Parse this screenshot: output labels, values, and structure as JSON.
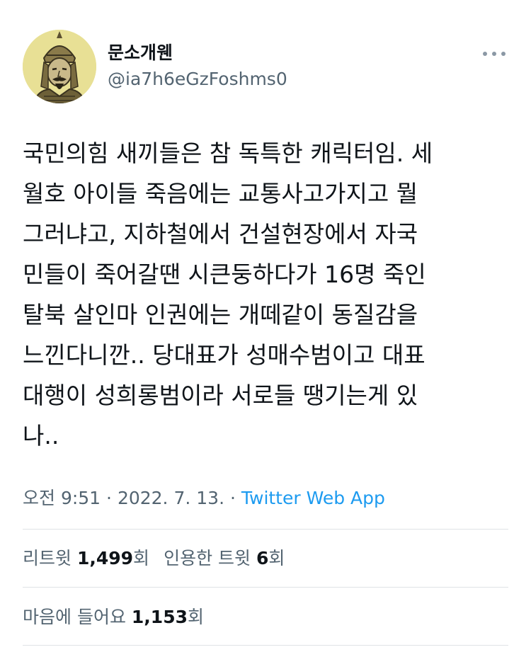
{
  "author": {
    "display_name": "문소개웬",
    "handle": "@ia7h6eGzFoshms0",
    "avatar_icon": "warrior-portrait-avatar"
  },
  "menu": {
    "icon": "more-options-icon"
  },
  "tweet": {
    "lines": [
      "국민의힘 새끼들은 참 독특한 캐릭터임. 세",
      "월호 아이들 죽음에는 교통사고가지고 뭘",
      "그러냐고, 지하철에서 건설현장에서 자국",
      "민들이 죽어갈땐 시큰둥하다가 16명 죽인",
      "탈북 살인마 인권에는 개떼같이 동질감을",
      "느낀다니깐.. 당대표가 성매수범이고 대표",
      "대행이 성희롱범이라 서로들 땡기는게 있",
      "나.."
    ]
  },
  "meta": {
    "time": "오전 9:51",
    "separator1": " · ",
    "date": "2022. 7. 13.",
    "separator2": " · ",
    "source": "Twitter Web App"
  },
  "stats": {
    "retweets_label": "리트윗",
    "retweets_count": "1,499",
    "retweets_unit": "회",
    "quotes_label": "인용한 트윗",
    "quotes_count": "6",
    "quotes_unit": "회",
    "likes_label": "마음에 들어요",
    "likes_count": "1,153",
    "likes_unit": "회"
  },
  "colors": {
    "text": "#0f1419",
    "secondary": "#536471",
    "link": "#1d9bf0",
    "divider": "#dfe3e6"
  }
}
